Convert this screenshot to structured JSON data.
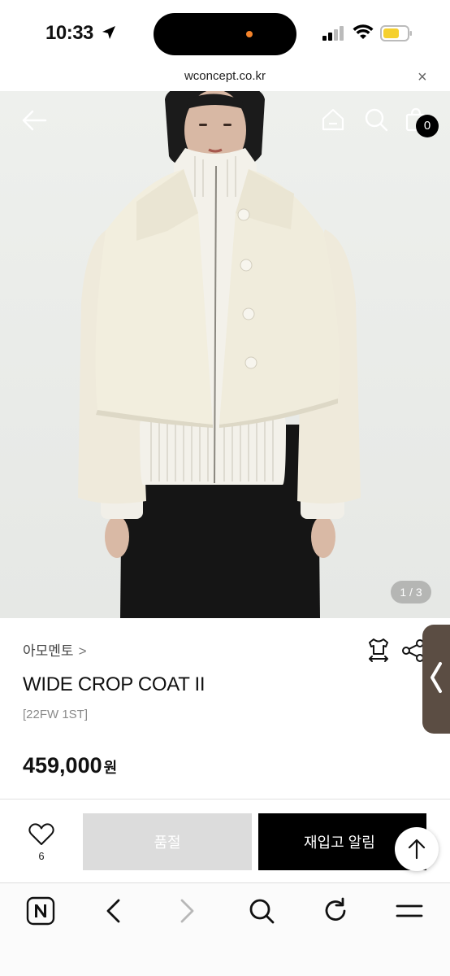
{
  "status_bar": {
    "time": "10:33"
  },
  "url_bar": {
    "url": "wconcept.co.kr",
    "close_glyph": "×"
  },
  "header": {
    "cart_count": "0"
  },
  "gallery": {
    "page_indicator": "1 / 3"
  },
  "product": {
    "brand": "아모멘토",
    "brand_chevron": ">",
    "name": "WIDE CROP COAT II",
    "code": "[22FW 1ST]",
    "price": "459,000",
    "price_unit": "원"
  },
  "actions": {
    "like_count": "6",
    "soldout_label": "품절",
    "notify_label": "재입고 알림"
  },
  "colors": {
    "accent": "#000000",
    "soldout_bg": "#dcdcdc",
    "side_tab": "#5b4d43",
    "battery": "#f5d02e",
    "island_dot": "#f5832a"
  },
  "icons": [
    "location-arrow-icon",
    "signal-icon",
    "wifi-icon",
    "battery-icon",
    "back-arrow-icon",
    "home-icon",
    "search-icon",
    "shopping-bag-icon",
    "size-guide-icon",
    "share-icon",
    "chevron-left-icon",
    "heart-icon",
    "arrow-up-icon",
    "naver-icon",
    "chevron-right-icon",
    "reload-icon",
    "menu-icon"
  ]
}
